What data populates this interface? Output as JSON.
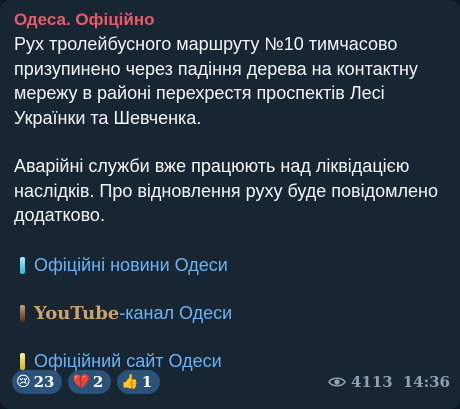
{
  "post": {
    "channel": "Одеса. Офіційно",
    "paragraphs": [
      "Рух тролейбусного маршруту №10 тимчасово призупинено через падіння дерева на контактну мережу в районі перехрестя проспектів Лесі Українки та Шевченка.",
      "Аварійні служби вже працюють над ліквідацією наслідків. Про відновлення руху буде повідомлено додатково."
    ],
    "links": [
      {
        "label": "Офіційні новини Одеси"
      },
      {
        "prefix": "YouTube",
        "label": "-канал Одеси"
      },
      {
        "label": "Офіційний сайт Одеси"
      }
    ]
  },
  "reactions": [
    {
      "icon": "crying-face-icon",
      "glyph": "😢",
      "count": "23"
    },
    {
      "icon": "broken-heart-icon",
      "glyph": "💔",
      "count": "2"
    },
    {
      "icon": "thumbs-up-icon",
      "glyph": "👍",
      "count": "1"
    }
  ],
  "meta": {
    "views": "4113",
    "time": "14:36"
  },
  "colors": {
    "background": "#0e1621",
    "bubble": "#182533",
    "channel_name": "#e85b6a",
    "link": "#6ab3f3",
    "reaction_pill": "#2b5278",
    "meta_text": "#8fa1b3"
  }
}
